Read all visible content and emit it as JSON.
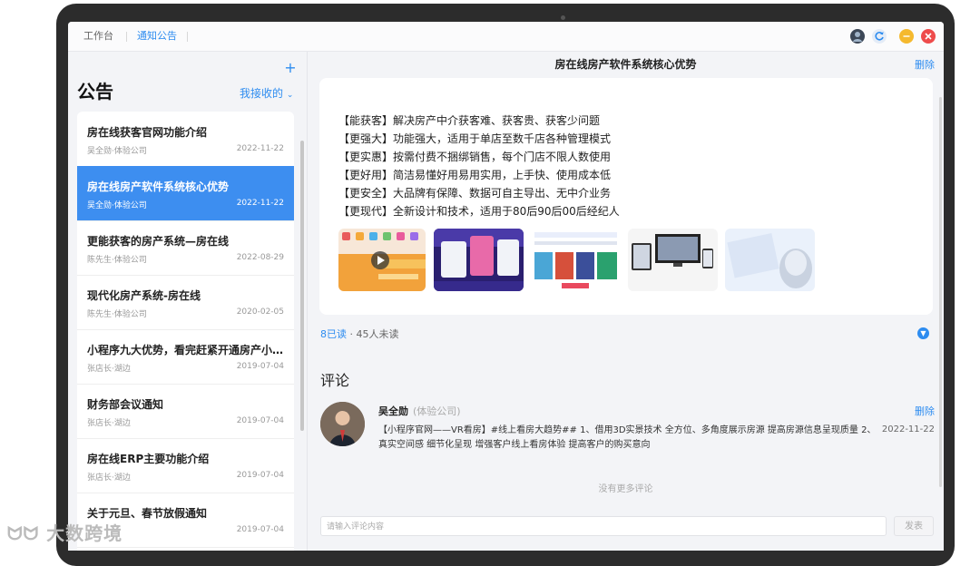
{
  "topbar": {
    "tabs": [
      "工作台",
      "通知公告"
    ],
    "colors": {
      "active": "#2d8cf0",
      "minimize": "#f5b92e",
      "close": "#ee4b4b"
    }
  },
  "sidebar": {
    "title": "公告",
    "filter": "我接收的",
    "add_icon": "plus-icon",
    "items": [
      {
        "title": "房在线获客官网功能介绍",
        "author": "吴全勋·体验公司",
        "date": "2022-11-22"
      },
      {
        "title": "房在线房产软件系统核心优势",
        "author": "吴全勋·体验公司",
        "date": "2022-11-22"
      },
      {
        "title": "更能获客的房产系统—房在线",
        "author": "陈先生·体验公司",
        "date": "2022-08-29"
      },
      {
        "title": "现代化房产系统-房在线",
        "author": "陈先生·体验公司",
        "date": "2020-02-05"
      },
      {
        "title": "小程序九大优势，看完赶紧开通房产小程序",
        "author": "张店长·湖边",
        "date": "2019-07-04"
      },
      {
        "title": "财务部会议通知",
        "author": "张店长·湖边",
        "date": "2019-07-04"
      },
      {
        "title": "房在线ERP主要功能介绍",
        "author": "张店长·湖边",
        "date": "2019-07-04"
      },
      {
        "title": "关于元旦、春节放假通知",
        "author": "",
        "date": "2019-07-04"
      }
    ]
  },
  "detail": {
    "title": "房在线房产软件系统核心优势",
    "delete": "删除",
    "lines": [
      "【能获客】解决房产中介获客难、获客贵、获客少问题",
      "【更强大】功能强大，适用于单店至数千店各种管理模式",
      "【更实惠】按需付费不捆绑销售，每个门店不限人数使用",
      "【更好用】简洁易懂好用易用实用，上手快、使用成本低",
      "【更安全】大品牌有保障、数据可自主导出、无中介业务",
      "【更现代】全新设计和技术，适用于80后90后00后经纪人"
    ],
    "read": "8已读",
    "unread": "· 45人未读"
  },
  "comments": {
    "title": "评论",
    "items": [
      {
        "name": "吴全勋",
        "org": "(体验公司)",
        "delete": "删除",
        "text": "【小程序官网——VR看房】#线上看房大趋势## 1、借用3D实景技术 全方位、多角度展示房源 提高房源信息呈现质量 2、真实空间感 细节化呈现 增强客户线上看房体验 提高客户的购买意向",
        "date": "2022-11-22"
      }
    ],
    "no_more": "没有更多评论",
    "input_placeholder": "请输入评论内容",
    "send": "发表"
  }
}
